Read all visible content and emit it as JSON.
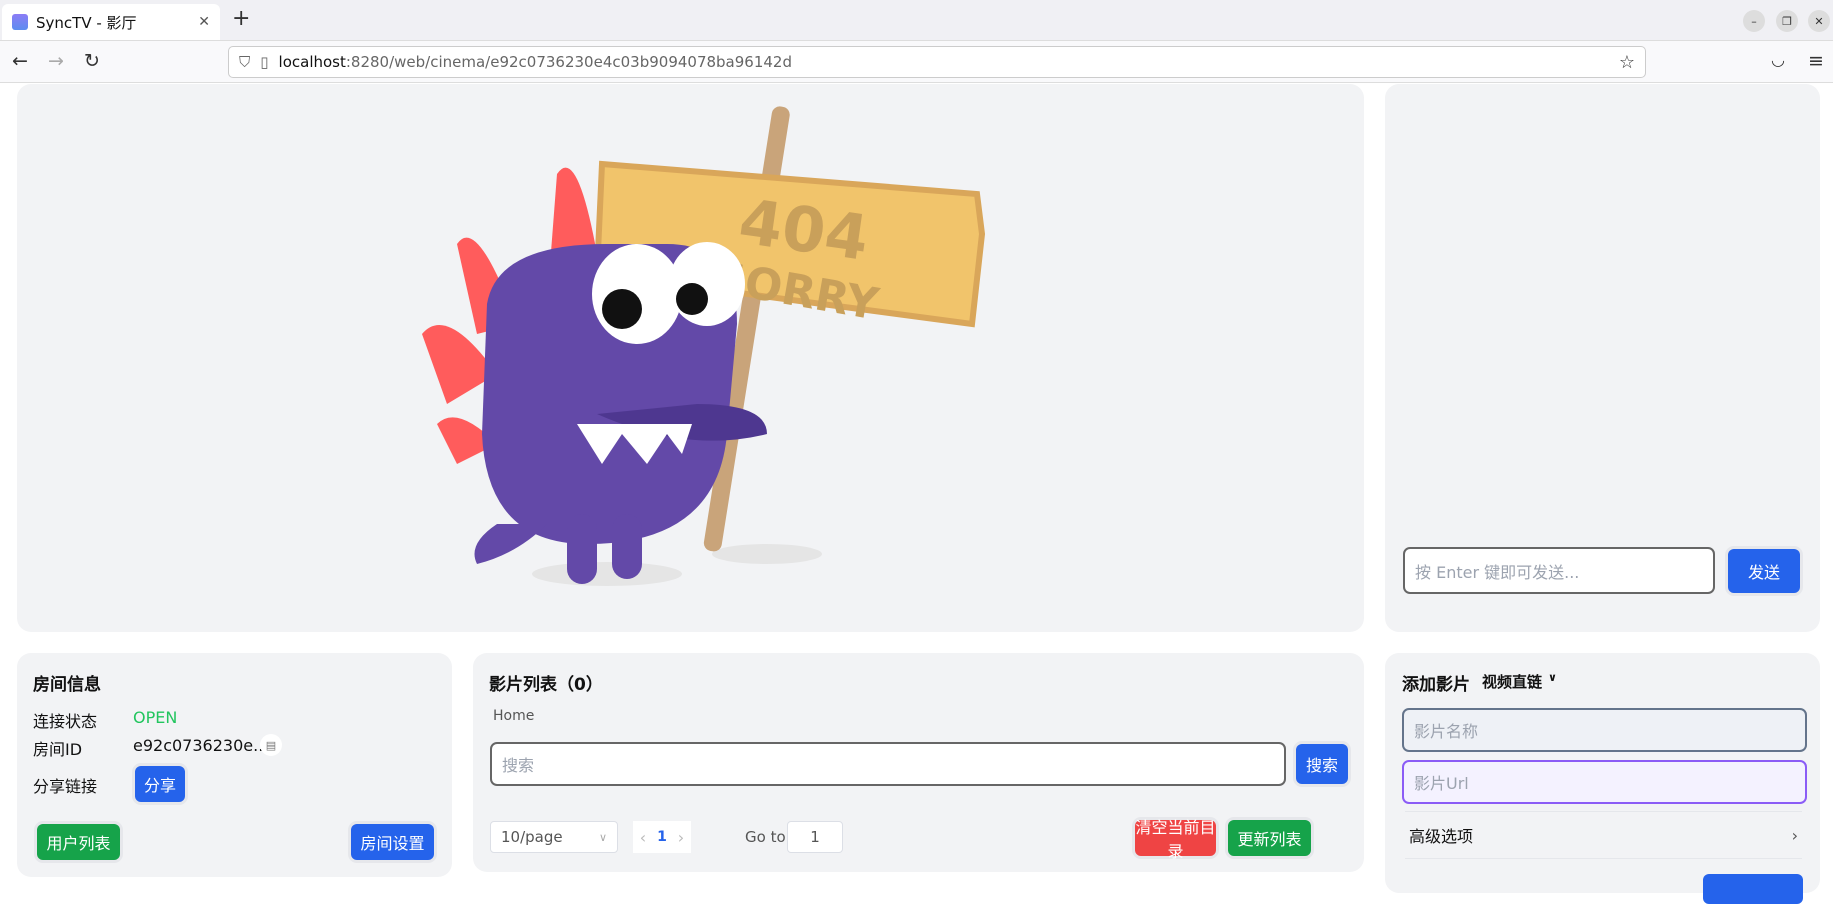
{
  "browser": {
    "tab_title": "SyncTV - 影厅",
    "url_host": "localhost",
    "url_path": ":8280/web/cinema/e92c0736230e4c03b9094078ba96142d"
  },
  "video": {
    "error_text_1": "404",
    "error_text_2": "SORRY"
  },
  "chat": {
    "input_placeholder": "按 Enter 键即可发送...",
    "send_label": "发送"
  },
  "room_info": {
    "title": "房间信息",
    "status_label": "连接状态",
    "status_value": "OPEN",
    "status_color": "#22c55e",
    "id_label": "房间ID",
    "id_value": "e92c0736230e...",
    "share_label": "分享链接",
    "share_button": "分享",
    "users_button": "用户列表",
    "settings_button": "房间设置"
  },
  "movie_list": {
    "title": "影片列表（0）",
    "breadcrumb": "Home",
    "search_placeholder": "搜索",
    "search_button": "搜索",
    "page_size": "10/page",
    "current_page": "1",
    "goto_label": "Go to",
    "goto_value": "1",
    "clear_button": "清空当前目录",
    "refresh_button": "更新列表"
  },
  "add_movie": {
    "title": "添加影片",
    "mode": "视频直链",
    "name_placeholder": "影片名称",
    "url_placeholder": "影片Url",
    "advanced_label": "高级选项"
  }
}
